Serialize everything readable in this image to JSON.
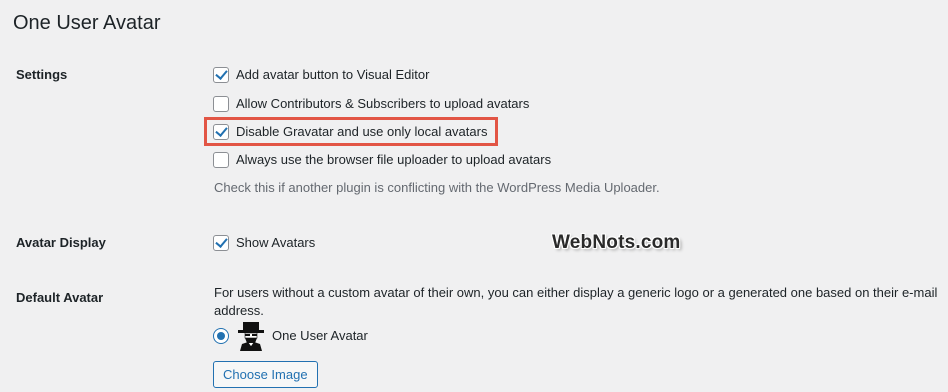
{
  "page": {
    "title": "One User Avatar"
  },
  "settings": {
    "label": "Settings",
    "options": [
      {
        "label": "Add avatar button to Visual Editor",
        "checked": true
      },
      {
        "label": "Allow Contributors & Subscribers to upload avatars",
        "checked": false
      },
      {
        "label": "Disable Gravatar and use only local avatars",
        "checked": true
      },
      {
        "label": "Always use the browser file uploader to upload avatars",
        "checked": false
      }
    ],
    "description": "Check this if another plugin is conflicting with the WordPress Media Uploader."
  },
  "avatar_display": {
    "label": "Avatar Display",
    "option": {
      "label": "Show Avatars",
      "checked": true
    }
  },
  "watermark": {
    "text": "WebNots.com"
  },
  "default_avatar": {
    "label": "Default Avatar",
    "description": "For users without a custom avatar of their own, you can either display a generic logo or a generated one based on their e-mail address.",
    "radio_label": "One User Avatar",
    "radio_selected": true,
    "button_label": "Choose Image"
  },
  "colors": {
    "accent": "#2271b1",
    "highlight": "#e25545",
    "background": "#f0f0f1"
  },
  "icons": {
    "checkbox_checked": "checkmark-icon",
    "avatar": "hat-person-avatar-icon"
  }
}
